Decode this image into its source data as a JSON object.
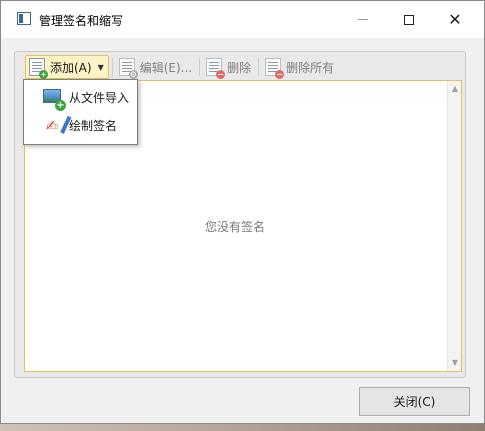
{
  "window": {
    "title": "管理签名和缩写"
  },
  "toolbar": {
    "add_label": "添加(A)",
    "edit_label": "编辑(E)...",
    "delete_label": "删除",
    "delete_all_label": "删除所有"
  },
  "dropdown": {
    "items": [
      {
        "label": "从文件导入",
        "icon": "image-import-icon"
      },
      {
        "label": "绘制签名",
        "icon": "draw-signature-icon"
      }
    ]
  },
  "list": {
    "empty_message": "您没有签名"
  },
  "footer": {
    "close_label": "关闭(C)"
  },
  "colors": {
    "accent_border": "#e2c25e",
    "active_fill": "#fdf3c6",
    "add_green": "#3aa63a",
    "delete_red": "#e06a6a"
  }
}
